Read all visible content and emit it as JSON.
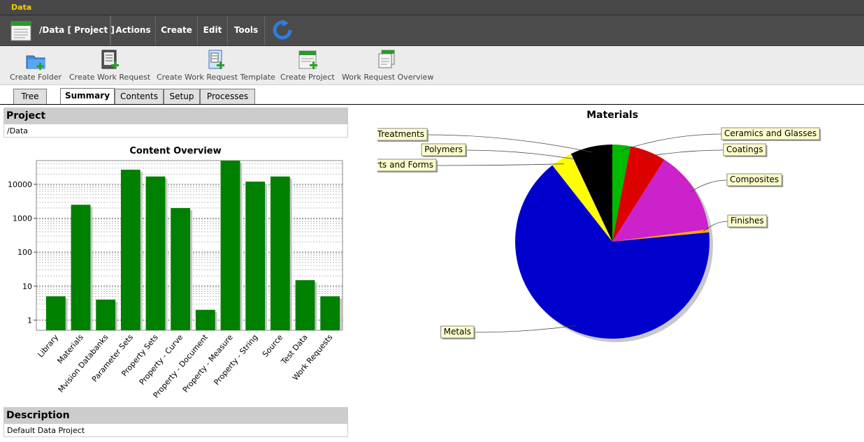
{
  "window": {
    "title": "Data"
  },
  "menubar": {
    "path": "/Data [  Project ]",
    "items": [
      "Actions",
      "Create",
      "Edit",
      "Tools"
    ]
  },
  "toolbar": {
    "create_folder": "Create Folder",
    "create_work_request": "Create Work Request",
    "create_work_request_template": "Create Work Request Template",
    "create_project": "Create Project",
    "work_request_overview": "Work Request Overview"
  },
  "tabs": [
    "Tree",
    "Summary",
    "Contents",
    "Setup",
    "Processes"
  ],
  "active_tab": "Summary",
  "project": {
    "heading": "Project",
    "value": "/Data"
  },
  "description": {
    "heading": "Description",
    "value": "Default Data Project"
  },
  "colors": {
    "bar": "#008000",
    "accent": "#ffcc00"
  },
  "chart_data": [
    {
      "type": "bar",
      "title": "Content Overview",
      "scale": "log",
      "ylim": [
        0.5,
        50000
      ],
      "yticks": [
        "1",
        "10",
        "100",
        "1000",
        "10000"
      ],
      "grid": true,
      "categories": [
        "Library",
        "Materials",
        "Mvision Databanks",
        "Parameter Sets",
        "Property Sets",
        "Property - Curve",
        "Property - Document",
        "Property - Measure",
        "Property - String",
        "Source",
        "Test Data",
        "Work Requests"
      ],
      "values": [
        5,
        2500,
        4,
        27000,
        17000,
        2000,
        2,
        50000,
        12000,
        17000,
        15,
        5
      ]
    },
    {
      "type": "pie",
      "title": "Materials",
      "labels": [
        "Ceramics and Glasses",
        "Coatings",
        "Composites",
        "Finishes",
        "Metals",
        "Parts and Forms",
        "Polymers",
        "Surface Treatments"
      ],
      "values": [
        3,
        6,
        14,
        0.5,
        66,
        3.5,
        0.1,
        7
      ],
      "colors": [
        "#00bb00",
        "#dd0000",
        "#cc22cc",
        "#ffaa00",
        "#0000cc",
        "#ffff00",
        "#ffffff",
        "#000000"
      ]
    }
  ]
}
